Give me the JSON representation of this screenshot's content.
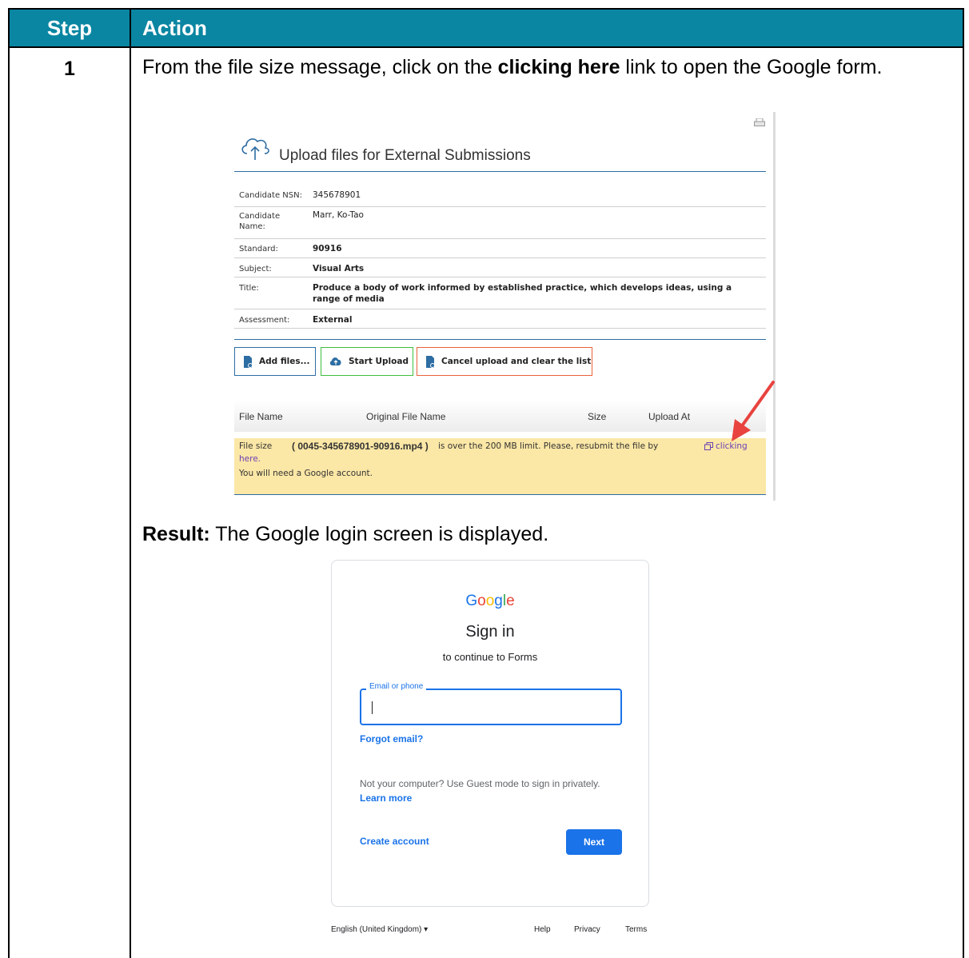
{
  "table": {
    "header": {
      "step": "Step",
      "action": "Action"
    },
    "row": {
      "step": "1",
      "instruction_pre": "From the file size message, click on the ",
      "instruction_bold": "clicking here",
      "instruction_post": " link to open the Google form.",
      "result_label": "Result:",
      "result_text": " The Google login screen is displayed."
    }
  },
  "upload": {
    "title": "Upload files for External Submissions",
    "fields": [
      {
        "label": "Candidate NSN:",
        "value": "345678901"
      },
      {
        "label": "Candidate Name:",
        "value": "Marr, Ko-Tao"
      },
      {
        "label": "Standard:",
        "value": "90916"
      },
      {
        "label": "Subject:",
        "value": "Visual Arts"
      },
      {
        "label": "Title:",
        "value": "Produce a body of work informed by established practice, which develops ideas, using a range of media"
      },
      {
        "label": "Assessment:",
        "value": "External"
      }
    ],
    "buttons": {
      "add": "Add files...",
      "start": "Start Upload",
      "cancel": "Cancel upload and clear the list"
    },
    "columns": [
      "File Name",
      "Original File Name",
      "Size",
      "Upload At"
    ],
    "warning": {
      "prefix": "File size",
      "filename": "( 0045-345678901-90916.mp4 )",
      "middle": "is over the 200 MB limit. Please, resubmit the file by",
      "link1": "clicking",
      "link2": "here.",
      "line2": "You will need a Google account."
    },
    "colors": {
      "rule": "#2d6da3",
      "warning_bg": "#fbe7a6",
      "arrow": "#e8433f"
    }
  },
  "google": {
    "logo": "Google",
    "title": "Sign in",
    "subtitle": "to continue to Forms",
    "field_label": "Email or phone",
    "forgot": "Forgot email?",
    "note": "Not your computer? Use Guest mode to sign in privately.",
    "learn_more": "Learn more",
    "create": "Create account",
    "next": "Next",
    "footer": {
      "language": "English (United Kingdom)",
      "help": "Help",
      "privacy": "Privacy",
      "terms": "Terms"
    },
    "colors": {
      "blue": "#1a73e8",
      "red": "#ea4335",
      "yellow": "#fbbc05",
      "green": "#34a853"
    }
  }
}
